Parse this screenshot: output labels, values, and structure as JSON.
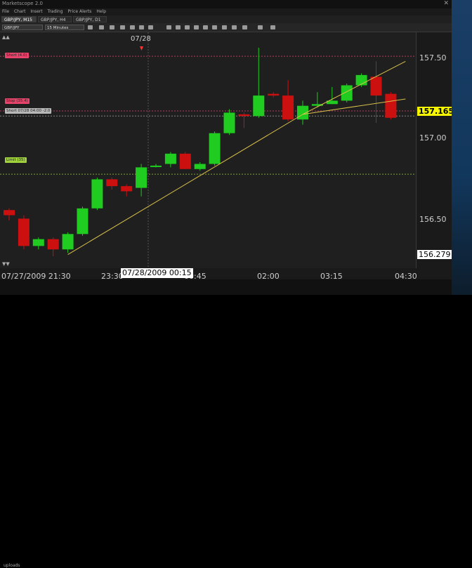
{
  "app": {
    "title": "Marketscope 2.0",
    "close_glyph": "✕",
    "menu": [
      "File",
      "Chart",
      "Insert",
      "Trading",
      "Price Alerts",
      "Help"
    ],
    "tabs": [
      "GBP/JPY, M15",
      "GBP/JPY, H4",
      "GBP/JPY, D1"
    ],
    "symbol": "GBP/JPY",
    "period": "15 Minutes",
    "status": "uploads"
  },
  "chart": {
    "cursor_date": "07/28",
    "price_label": "157.165",
    "low_label": "156.279",
    "cursor_time": "07/28/2009 00:15",
    "y_ticks": [
      "157.50",
      "157.00",
      "156.50"
    ],
    "x_ticks": [
      "07/27/2009 21:30",
      "23:30",
      "00:45",
      "02:00",
      "03:15",
      "04:30"
    ],
    "orders": [
      {
        "label": "Short (4.0)",
        "color": "#e8446b"
      },
      {
        "label": "Stop (35.4)",
        "color": "#e8446b"
      },
      {
        "label": "Short 07/28 04:00 -2.0",
        "color": "#b8b8b8"
      },
      {
        "label": "Limit (35)",
        "color": "#9fd23b"
      }
    ]
  },
  "chart_data": {
    "type": "candlestick",
    "series": [
      {
        "o": 156.62,
        "c": 156.59,
        "h": 156.63,
        "l": 156.56
      },
      {
        "o": 156.57,
        "c": 156.41,
        "h": 156.59,
        "l": 156.39
      },
      {
        "o": 156.41,
        "c": 156.45,
        "h": 156.46,
        "l": 156.39
      },
      {
        "o": 156.45,
        "c": 156.39,
        "h": 156.46,
        "l": 156.35
      },
      {
        "o": 156.39,
        "c": 156.48,
        "h": 156.49,
        "l": 156.37
      },
      {
        "o": 156.48,
        "c": 156.63,
        "h": 156.64,
        "l": 156.47
      },
      {
        "o": 156.63,
        "c": 156.8,
        "h": 156.81,
        "l": 156.62
      },
      {
        "o": 156.8,
        "c": 156.76,
        "h": 156.81,
        "l": 156.74
      },
      {
        "o": 156.76,
        "c": 156.73,
        "h": 156.77,
        "l": 156.7
      },
      {
        "o": 156.75,
        "c": 156.87,
        "h": 156.89,
        "l": 156.7
      },
      {
        "o": 156.88,
        "c": 156.88,
        "h": 156.89,
        "l": 156.87
      },
      {
        "o": 156.89,
        "c": 156.95,
        "h": 156.96,
        "l": 156.87
      },
      {
        "o": 156.95,
        "c": 156.86,
        "h": 156.96,
        "l": 156.86
      },
      {
        "o": 156.86,
        "c": 156.89,
        "h": 156.9,
        "l": 156.85
      },
      {
        "o": 156.89,
        "c": 157.07,
        "h": 157.08,
        "l": 156.88
      },
      {
        "o": 157.07,
        "c": 157.19,
        "h": 157.21,
        "l": 157.06
      },
      {
        "o": 157.18,
        "c": 157.17,
        "h": 157.19,
        "l": 157.1
      },
      {
        "o": 157.17,
        "c": 157.29,
        "h": 157.57,
        "l": 157.16
      },
      {
        "o": 157.3,
        "c": 157.29,
        "h": 157.31,
        "l": 157.28
      },
      {
        "o": 157.29,
        "c": 157.15,
        "h": 157.38,
        "l": 157.14
      },
      {
        "o": 157.15,
        "c": 157.23,
        "h": 157.26,
        "l": 157.12
      },
      {
        "o": 157.23,
        "c": 157.24,
        "h": 157.31,
        "l": 157.22
      },
      {
        "o": 157.24,
        "c": 157.26,
        "h": 157.34,
        "l": 157.24
      },
      {
        "o": 157.26,
        "c": 157.35,
        "h": 157.36,
        "l": 157.25
      },
      {
        "o": 157.35,
        "c": 157.41,
        "h": 157.42,
        "l": 157.34
      },
      {
        "o": 157.4,
        "c": 157.29,
        "h": 157.49,
        "l": 157.13
      },
      {
        "o": 157.3,
        "c": 157.16,
        "h": 157.31,
        "l": 157.15
      }
    ],
    "trendlines": [
      {
        "from": [
          4,
          156.36
        ],
        "to": [
          20,
          157.18
        ]
      },
      {
        "from": [
          20,
          157.18
        ],
        "to": [
          27,
          157.49
        ]
      },
      {
        "from": [
          20,
          157.18
        ],
        "to": [
          27,
          157.27
        ]
      }
    ],
    "levels": [
      157.52,
      157.2,
      157.17,
      156.83
    ],
    "ylim": [
      156.28,
      157.66
    ],
    "up_color": "#1fcc1f",
    "down_color": "#cc1010"
  }
}
